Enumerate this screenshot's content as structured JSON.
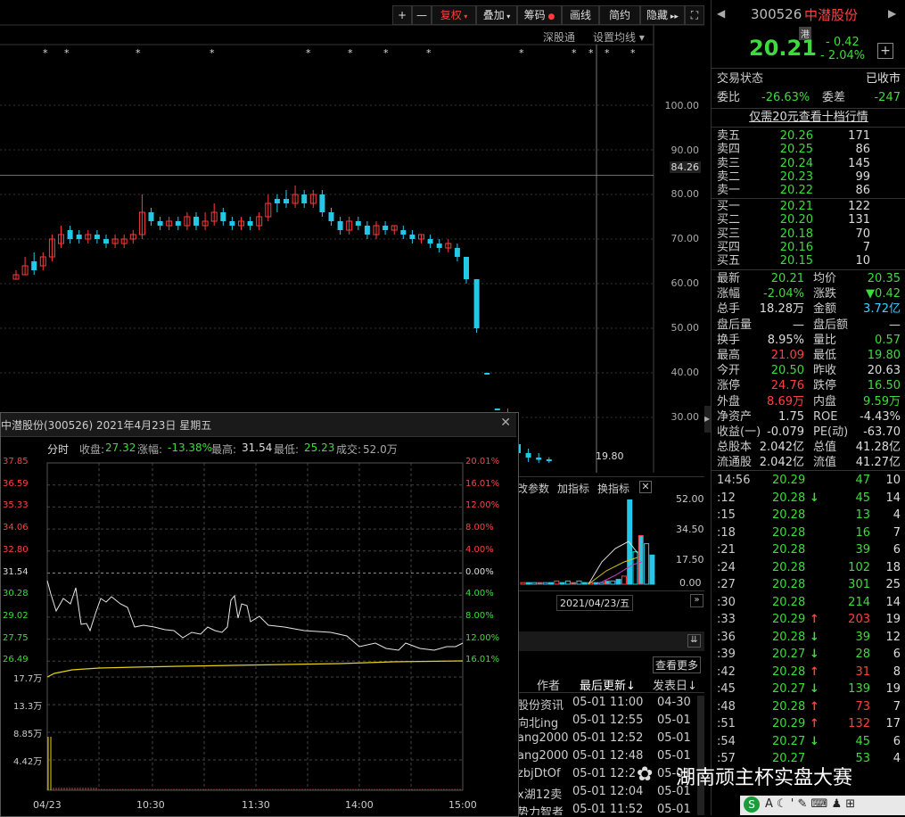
{
  "toolbar": {
    "buttons": [
      "+",
      "—",
      "复权",
      "叠加",
      "筹码",
      "画线",
      "简约",
      "隐藏"
    ],
    "links": [
      "深股通",
      "设置均线"
    ]
  },
  "main_chart": {
    "price_axis": [
      "100.00",
      "90.00",
      "84.26",
      "80.00",
      "70.00",
      "60.00",
      "50.00",
      "40.00",
      "30.00"
    ],
    "low_label": "19.80",
    "vol_axis": [
      "52.00",
      "34.50",
      "17.50",
      "0.00"
    ],
    "vol_toolbar": [
      "改参数",
      "加指标",
      "换指标"
    ],
    "date_label": "2021/04/23/五"
  },
  "chart_data": {
    "type": "candlestick",
    "ylim": [
      0,
      105
    ],
    "candles": [
      {
        "o": 61,
        "c": 62,
        "h": 63,
        "l": 61,
        "up": true
      },
      {
        "o": 62,
        "c": 64,
        "h": 66,
        "l": 62,
        "up": true
      },
      {
        "o": 63,
        "c": 65,
        "h": 67,
        "l": 62,
        "up": false
      },
      {
        "o": 64,
        "c": 66,
        "h": 67,
        "l": 63,
        "up": true
      },
      {
        "o": 66,
        "c": 70,
        "h": 71,
        "l": 65,
        "up": true
      },
      {
        "o": 69,
        "c": 71,
        "h": 73,
        "l": 68,
        "up": true
      },
      {
        "o": 70,
        "c": 72,
        "h": 73,
        "l": 69,
        "up": false
      },
      {
        "o": 71,
        "c": 70,
        "h": 72,
        "l": 69,
        "up": false
      },
      {
        "o": 70,
        "c": 71,
        "h": 72,
        "l": 69,
        "up": true
      },
      {
        "o": 71,
        "c": 70,
        "h": 72,
        "l": 69,
        "up": false
      },
      {
        "o": 70,
        "c": 69,
        "h": 71,
        "l": 68,
        "up": false
      },
      {
        "o": 69,
        "c": 70,
        "h": 71,
        "l": 68,
        "up": true
      },
      {
        "o": 69,
        "c": 70,
        "h": 71,
        "l": 68,
        "up": true
      },
      {
        "o": 70,
        "c": 71,
        "h": 72,
        "l": 69,
        "up": true
      },
      {
        "o": 71,
        "c": 76,
        "h": 80,
        "l": 70,
        "up": true
      },
      {
        "o": 76,
        "c": 74,
        "h": 77,
        "l": 73,
        "up": false
      },
      {
        "o": 74,
        "c": 73,
        "h": 75,
        "l": 72,
        "up": false
      },
      {
        "o": 73,
        "c": 74,
        "h": 75,
        "l": 72,
        "up": true
      },
      {
        "o": 74,
        "c": 73,
        "h": 75,
        "l": 72,
        "up": false
      },
      {
        "o": 73,
        "c": 75,
        "h": 76,
        "l": 72,
        "up": true
      },
      {
        "o": 75,
        "c": 73,
        "h": 76,
        "l": 72,
        "up": false
      },
      {
        "o": 73,
        "c": 74,
        "h": 76,
        "l": 72,
        "up": true
      },
      {
        "o": 74,
        "c": 76,
        "h": 78,
        "l": 73,
        "up": true
      },
      {
        "o": 76,
        "c": 74,
        "h": 77,
        "l": 73,
        "up": false
      },
      {
        "o": 74,
        "c": 73,
        "h": 75,
        "l": 72,
        "up": false
      },
      {
        "o": 73,
        "c": 74,
        "h": 75,
        "l": 72,
        "up": true
      },
      {
        "o": 74,
        "c": 73,
        "h": 75,
        "l": 72,
        "up": false
      },
      {
        "o": 73,
        "c": 75,
        "h": 76,
        "l": 72,
        "up": true
      },
      {
        "o": 75,
        "c": 78,
        "h": 80,
        "l": 74,
        "up": true
      },
      {
        "o": 78,
        "c": 79,
        "h": 80,
        "l": 76,
        "up": false
      },
      {
        "o": 79,
        "c": 78,
        "h": 81,
        "l": 77,
        "up": false
      },
      {
        "o": 78,
        "c": 80,
        "h": 82,
        "l": 77,
        "up": true
      },
      {
        "o": 80,
        "c": 78,
        "h": 81,
        "l": 77,
        "up": false
      },
      {
        "o": 78,
        "c": 80,
        "h": 81,
        "l": 77,
        "up": true
      },
      {
        "o": 80,
        "c": 76,
        "h": 81,
        "l": 75,
        "up": false
      },
      {
        "o": 76,
        "c": 74,
        "h": 77,
        "l": 73,
        "up": false
      },
      {
        "o": 74,
        "c": 72,
        "h": 75,
        "l": 71,
        "up": false
      },
      {
        "o": 72,
        "c": 74,
        "h": 75,
        "l": 71,
        "up": true
      },
      {
        "o": 74,
        "c": 73,
        "h": 75,
        "l": 72,
        "up": false
      },
      {
        "o": 73,
        "c": 71,
        "h": 74,
        "l": 70,
        "up": false
      },
      {
        "o": 71,
        "c": 73,
        "h": 74,
        "l": 70,
        "up": true
      },
      {
        "o": 73,
        "c": 72,
        "h": 74,
        "l": 71,
        "up": false
      },
      {
        "o": 72,
        "c": 73,
        "h": 73,
        "l": 71,
        "up": true
      },
      {
        "o": 72,
        "c": 71,
        "h": 73,
        "l": 70,
        "up": false
      },
      {
        "o": 71,
        "c": 70,
        "h": 72,
        "l": 69,
        "up": false
      },
      {
        "o": 70,
        "c": 71,
        "h": 71,
        "l": 69,
        "up": true
      },
      {
        "o": 70,
        "c": 69,
        "h": 71,
        "l": 68,
        "up": false
      },
      {
        "o": 69,
        "c": 68,
        "h": 70,
        "l": 67,
        "up": false
      },
      {
        "o": 68,
        "c": 69,
        "h": 70,
        "l": 67,
        "up": true
      },
      {
        "o": 68,
        "c": 66,
        "h": 69,
        "l": 65,
        "up": false
      },
      {
        "o": 66,
        "c": 61,
        "h": 66,
        "l": 60,
        "up": false
      },
      {
        "o": 61,
        "c": 50,
        "h": 61,
        "l": 49,
        "up": false
      },
      {
        "o": 40,
        "c": 40,
        "h": 40,
        "l": 40,
        "up": false
      },
      {
        "o": 32,
        "c": 32,
        "h": 32,
        "l": 32,
        "up": false
      },
      {
        "o": 28,
        "c": 26,
        "h": 32,
        "l": 26,
        "up": true
      },
      {
        "o": 24,
        "c": 22,
        "h": 25,
        "l": 22,
        "up": false
      },
      {
        "o": 22,
        "c": 21,
        "h": 23,
        "l": 20,
        "up": false
      },
      {
        "o": 21,
        "c": 20.5,
        "h": 22,
        "l": 19.8,
        "up": false
      },
      {
        "o": 20.6,
        "c": 20.2,
        "h": 21.1,
        "l": 19.8,
        "up": false
      }
    ],
    "volumes": [
      1,
      1,
      1,
      1,
      1,
      1,
      2,
      1,
      2,
      1,
      2,
      1,
      1,
      1,
      1,
      2,
      2,
      3,
      5,
      52,
      20,
      30,
      25,
      18
    ]
  },
  "quote": {
    "code": "300526",
    "name": "中潜股份",
    "price": "20.21",
    "change": "- 0.42",
    "change_pct": "- 2.04%",
    "tag": "港",
    "trade_status_label": "交易状态",
    "trade_status": "已收市",
    "weibi_label": "委比",
    "weibi": "-26.63%",
    "weicha_label": "委差",
    "weicha": "-247",
    "promo": "仅需20元查看十档行情",
    "asks": [
      {
        "label": "卖五",
        "price": "20.26",
        "vol": "171"
      },
      {
        "label": "卖四",
        "price": "20.25",
        "vol": "86"
      },
      {
        "label": "卖三",
        "price": "20.24",
        "vol": "145"
      },
      {
        "label": "卖二",
        "price": "20.23",
        "vol": "99"
      },
      {
        "label": "卖一",
        "price": "20.22",
        "vol": "86"
      }
    ],
    "bids": [
      {
        "label": "买一",
        "price": "20.21",
        "vol": "122"
      },
      {
        "label": "买二",
        "price": "20.20",
        "vol": "131"
      },
      {
        "label": "买三",
        "price": "20.18",
        "vol": "70"
      },
      {
        "label": "买四",
        "price": "20.16",
        "vol": "7"
      },
      {
        "label": "买五",
        "price": "20.15",
        "vol": "10"
      }
    ],
    "stats": [
      {
        "l1": "最新",
        "v1": "20.21",
        "c1": "green",
        "l2": "均价",
        "v2": "20.35",
        "c2": "green"
      },
      {
        "l1": "涨幅",
        "v1": "-2.04%",
        "c1": "green",
        "l2": "涨跌",
        "v2": "▼0.42",
        "c2": "green"
      },
      {
        "l1": "总手",
        "v1": "18.28万",
        "c1": "white",
        "l2": "金额",
        "v2": "3.72亿",
        "c2": "cyan"
      },
      {
        "l1": "盘后量",
        "v1": "—",
        "c1": "white",
        "l2": "盘后额",
        "v2": "—",
        "c2": "white"
      },
      {
        "l1": "换手",
        "v1": "8.95%",
        "c1": "white",
        "l2": "量比",
        "v2": "0.57",
        "c2": "green"
      },
      {
        "l1": "最高",
        "v1": "21.09",
        "c1": "red",
        "l2": "最低",
        "v2": "19.80",
        "c2": "green"
      },
      {
        "l1": "今开",
        "v1": "20.50",
        "c1": "green",
        "l2": "昨收",
        "v2": "20.63",
        "c2": "white"
      },
      {
        "l1": "涨停",
        "v1": "24.76",
        "c1": "red",
        "l2": "跌停",
        "v2": "16.50",
        "c2": "green"
      },
      {
        "l1": "外盘",
        "v1": "8.69万",
        "c1": "red",
        "l2": "内盘",
        "v2": "9.59万",
        "c2": "green"
      },
      {
        "l1": "净资产",
        "v1": "1.75",
        "c1": "white",
        "l2": "ROE",
        "v2": "-4.43%",
        "c2": "white"
      },
      {
        "l1": "收益(一)",
        "v1": "-0.079",
        "c1": "white",
        "l2": "PE(动)",
        "v2": "-63.70",
        "c2": "white"
      },
      {
        "l1": "总股本",
        "v1": "2.042亿",
        "c1": "white",
        "l2": "总值",
        "v2": "41.28亿",
        "c2": "white"
      },
      {
        "l1": "流通股",
        "v1": "2.042亿",
        "c1": "white",
        "l2": "流值",
        "v2": "41.27亿",
        "c2": "white"
      }
    ],
    "ticks": [
      {
        "t": "14:56",
        "p": "20.29",
        "a": "",
        "v": "47",
        "vc": "green",
        "n": "10"
      },
      {
        "t": ":12",
        "p": "20.28",
        "a": "↓",
        "v": "45",
        "vc": "green",
        "n": "14"
      },
      {
        "t": ":15",
        "p": "20.28",
        "a": "",
        "v": "13",
        "vc": "green",
        "n": "4"
      },
      {
        "t": ":18",
        "p": "20.28",
        "a": "",
        "v": "16",
        "vc": "green",
        "n": "7"
      },
      {
        "t": ":21",
        "p": "20.28",
        "a": "",
        "v": "39",
        "vc": "green",
        "n": "6"
      },
      {
        "t": ":24",
        "p": "20.28",
        "a": "",
        "v": "102",
        "vc": "green",
        "n": "18"
      },
      {
        "t": ":27",
        "p": "20.28",
        "a": "",
        "v": "301",
        "vc": "green",
        "n": "25"
      },
      {
        "t": ":30",
        "p": "20.28",
        "a": "",
        "v": "214",
        "vc": "green",
        "n": "14"
      },
      {
        "t": ":33",
        "p": "20.29",
        "a": "↑",
        "v": "203",
        "vc": "red",
        "n": "19"
      },
      {
        "t": ":36",
        "p": "20.28",
        "a": "↓",
        "v": "39",
        "vc": "green",
        "n": "12"
      },
      {
        "t": ":39",
        "p": "20.27",
        "a": "↓",
        "v": "28",
        "vc": "green",
        "n": "6"
      },
      {
        "t": ":42",
        "p": "20.28",
        "a": "↑",
        "v": "31",
        "vc": "red",
        "n": "8"
      },
      {
        "t": ":45",
        "p": "20.27",
        "a": "↓",
        "v": "139",
        "vc": "green",
        "n": "19"
      },
      {
        "t": ":48",
        "p": "20.28",
        "a": "↑",
        "v": "73",
        "vc": "red",
        "n": "7"
      },
      {
        "t": ":51",
        "p": "20.29",
        "a": "↑",
        "v": "132",
        "vc": "red",
        "n": "17"
      },
      {
        "t": ":54",
        "p": "20.27",
        "a": "↓",
        "v": "45",
        "vc": "green",
        "n": "6"
      },
      {
        "t": ":57",
        "p": "20.27",
        "a": "",
        "v": "53",
        "vc": "green",
        "n": "4"
      }
    ]
  },
  "popup": {
    "title": "中潜股份(300526) 2021年4月23日 星期五",
    "fenshi": "分时",
    "close_label": "收盘:",
    "close": "27.32",
    "chg_label": "涨幅:",
    "chg": "-13.38%",
    "high_label": "最高:",
    "high": "31.54",
    "low_label": "最低:",
    "low": "25.23",
    "vol_label": "成交:",
    "vol": "52.0万",
    "left_axis": [
      "37.85",
      "36.59",
      "35.33",
      "34.06",
      "32.80",
      "31.54",
      "30.28",
      "29.02",
      "27.75",
      "26.49"
    ],
    "right_axis": [
      "20.01%",
      "16.01%",
      "12.00%",
      "8.00%",
      "4.00%",
      "0.00%",
      "4.00%",
      "8.00%",
      "12.00%",
      "16.01%"
    ],
    "vol_axis": [
      "17.7万",
      "13.3万",
      "8.85万",
      "4.42万"
    ],
    "time_axis": [
      "04/23",
      "10:30",
      "11:30",
      "14:00",
      "15:00"
    ]
  },
  "news": {
    "more": "查看更多",
    "headers": [
      "作者",
      "最后更新↓",
      "发表日↓"
    ],
    "rows": [
      {
        "a": "股份资讯",
        "u": "05-01 11:00",
        "d": "04-30"
      },
      {
        "a": "向北ing",
        "u": "05-01 12:55",
        "d": "05-01"
      },
      {
        "a": "ang2000",
        "u": "05-01 12:52",
        "d": "05-01"
      },
      {
        "a": "ang2000",
        "u": "05-01 12:48",
        "d": "05-01"
      },
      {
        "a": "zbjDtOf",
        "u": "05-01 12:2",
        "d": "05-01"
      },
      {
        "a": "x湖12卖",
        "u": "05-01 12:04",
        "d": "05-01"
      },
      {
        "a": "势力智者",
        "u": "05-01 11:52",
        "d": "05-01"
      }
    ]
  },
  "watermark": "湖南顽主杯实盘大赛"
}
